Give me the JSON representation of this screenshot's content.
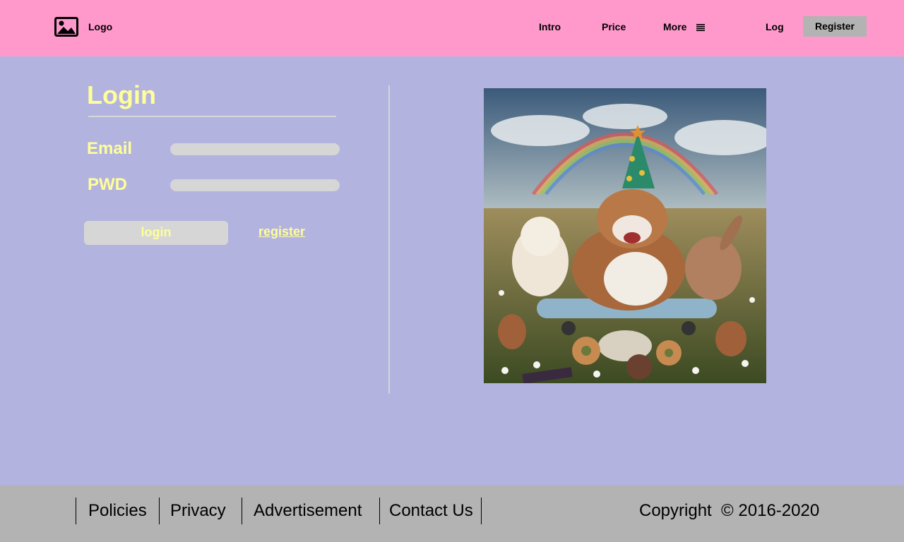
{
  "header": {
    "logo_icon": "image-icon",
    "logo_text": "Logo",
    "nav": {
      "intro": "Intro",
      "price": "Price",
      "more": "More",
      "more_icon": "menu-icon",
      "log": "Log",
      "register": "Register"
    },
    "bg_color": "#ff99cc"
  },
  "login": {
    "title": "Login",
    "email_label": "Email",
    "email_value": "",
    "pwd_label": "PWD",
    "pwd_value": "",
    "login_button": "login",
    "register_link": "register",
    "accent_color": "#ffff99"
  },
  "picture": {
    "subject": "party-animals-illustration"
  },
  "footer": {
    "links": {
      "policies": "Policies",
      "privacy": "Privacy",
      "advertisement": "Advertisement",
      "contact": "Contact Us"
    },
    "copyright": "Copyright  © 2016-2020",
    "bg_color": "#b3b3b3"
  },
  "page_bg_color": "#b3b3e0"
}
